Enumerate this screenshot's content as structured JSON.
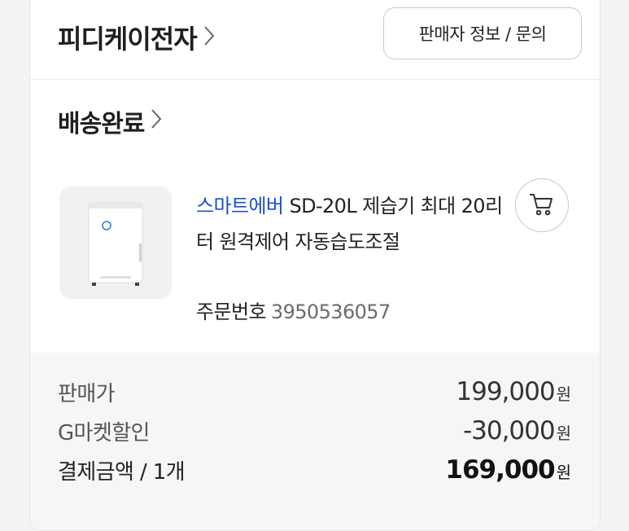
{
  "seller": {
    "name": "피디케이전자",
    "info_button": "판매자 정보 / 문의"
  },
  "order": {
    "status": "배송완료",
    "product": {
      "brand": "스마트에버",
      "title": "SD-20L 제습기 최대 20리터 원격제어 자동습도조절"
    },
    "order_number_label": "주문번호",
    "order_number": "3950536057"
  },
  "summary": {
    "rows": [
      {
        "label": "판매가",
        "amount": "199,000",
        "unit": "원"
      },
      {
        "label": "G마켓할인",
        "amount": "-30,000",
        "unit": "원"
      },
      {
        "label": "결제금액 / 1개",
        "amount": "169,000",
        "unit": "원"
      }
    ]
  },
  "colors": {
    "brand_link": "#1e4fd1",
    "summary_bg": "#f6f6f6"
  }
}
